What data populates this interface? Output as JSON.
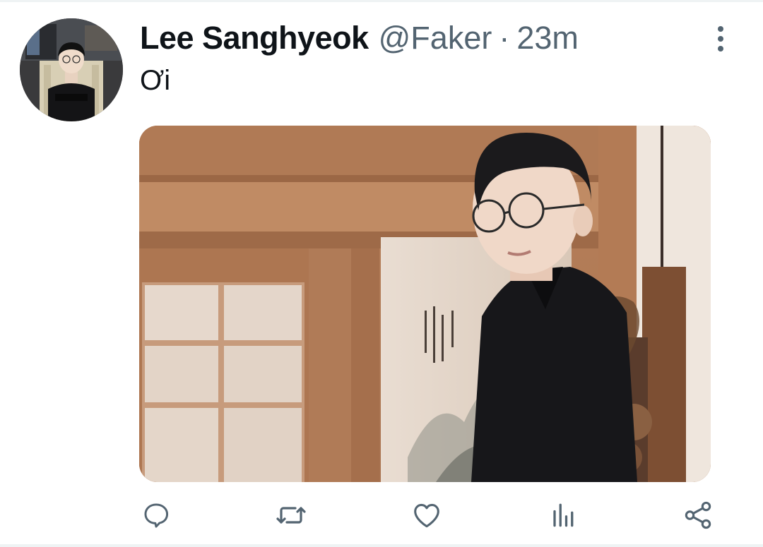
{
  "tweet": {
    "author_name": "Lee Sanghyeok",
    "handle": "@Faker",
    "separator": "·",
    "time": "23m",
    "text": "Ơi"
  },
  "icons": {
    "more": "more-vertical-icon",
    "reply": "reply-icon",
    "retweet": "retweet-icon",
    "like": "heart-icon",
    "analytics": "analytics-icon",
    "share": "share-icon"
  },
  "colors": {
    "primary_text": "#0f1419",
    "secondary_text": "#536471",
    "divider": "#eff3f4"
  }
}
